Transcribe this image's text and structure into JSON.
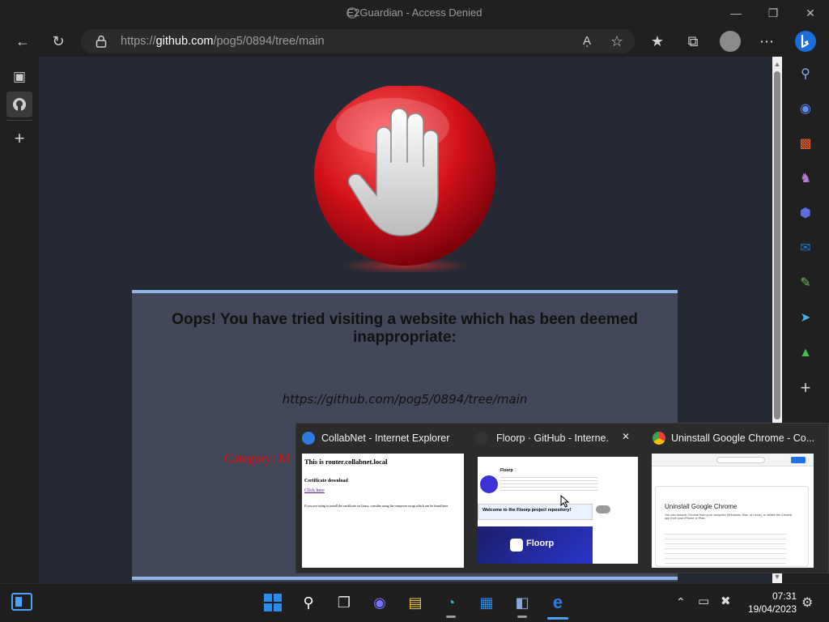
{
  "window": {
    "title": "E2Guardian - Access Denied",
    "minimize": "—",
    "restore": "❐",
    "close": "✕"
  },
  "toolbar": {
    "url_prefix": "https://",
    "url_domain": "github.com",
    "url_path": "/pog5/0894/tree/main"
  },
  "page": {
    "heading": "Oops! You have tried visiting a website which has been deemed inappropriate:",
    "blocked_url": "https://github.com/pog5/0894/tree/main",
    "category": "Category: M"
  },
  "thumbnails": [
    {
      "title": "CollabNet - Internet Explorer",
      "preview": {
        "heading": "This is router.collabnet.local",
        "line1": "Certificate download",
        "link": "Click here",
        "note": "If you are trying to install the certificate on Linux, consider using the composer script which can be found here"
      }
    },
    {
      "title": "Floorp · GitHub - Interne...",
      "close": "✕",
      "preview": {
        "heading": "Floorp",
        "banner": "Welcome to the Floorp project repository!",
        "logo_text": "Floorp"
      }
    },
    {
      "title": "Uninstall Google Chrome - Co...",
      "preview": {
        "heading": "Uninstall Google Chrome",
        "text": "You can remove Chrome from your computer (Windows, Mac, or Linux), or delete the Chrome app from your iPhone or iPad."
      }
    }
  ],
  "clock": {
    "time": "07:31",
    "date": "19/04/2023"
  },
  "colors": {
    "accent": "#8fb4e6",
    "stop_red": "#d0101a",
    "category_red": "#e01010"
  }
}
